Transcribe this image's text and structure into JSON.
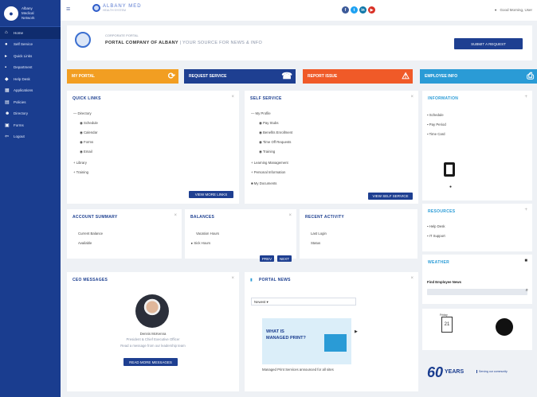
{
  "sidebar": {
    "brand": [
      "Albany",
      "Medical",
      "Network"
    ],
    "items": [
      "Home",
      "Self Service",
      "Quick Links",
      "Department",
      "Help Desk",
      "Applications",
      "Policies",
      "Directory",
      "Forms",
      "Logout"
    ]
  },
  "topbar": {
    "brand": "ALBANY MED",
    "brand_sub": "HEALTH SYSTEM",
    "user": "Good Morning, User"
  },
  "header": {
    "crumb": "CORPORATE PORTAL",
    "title": "PORTAL COMPANY OF ALBANY",
    "subtitle": "| YOUR SOURCE FOR NEWS & INFO",
    "button": "SUBMIT A REQUEST"
  },
  "tiles": [
    "MY PORTAL",
    "REQUEST SERVICE",
    "REPORT ISSUE",
    "EMPLOYEE INFO"
  ],
  "quick_links": {
    "title": "QUICK LINKS",
    "items": [
      "Directory",
      "Schedule",
      "Calendar",
      "Forms",
      "Email",
      "Library",
      "Training"
    ],
    "button": "VIEW MORE LINKS"
  },
  "self_service": {
    "title": "SELF SERVICE",
    "items": [
      "My Profile",
      "Pay Stubs",
      "Benefits Enrollment",
      "Time Off Requests",
      "Training",
      "Learning Management",
      "Personal Information",
      "My Documents"
    ],
    "button": "VIEW SELF SERVICE"
  },
  "right_info": {
    "title": "INFORMATION",
    "items": [
      "Schedule",
      "Pay Period",
      "Time Card"
    ]
  },
  "right_links": {
    "title": "RESOURCES",
    "items": [
      "Help Desk",
      "IT Support"
    ]
  },
  "row2": [
    {
      "title": "ACCOUNT SUMMARY",
      "items": [
        "Current Balance",
        "Available"
      ]
    },
    {
      "title": "BALANCES",
      "items": [
        "Vacation Hours",
        "Sick Hours"
      ]
    },
    {
      "title": "RECENT ACTIVITY",
      "items": [
        "Last Login",
        "Status"
      ]
    }
  ],
  "pager": [
    "PREV",
    "NEXT"
  ],
  "ceo": {
    "title": "CEO MESSAGES",
    "name": "Dennis McKenna",
    "role": "President & Chief Executive Officer",
    "caption": "Read a message from our leadership team",
    "button": "READ MORE MESSAGES"
  },
  "news": {
    "title": "PORTAL NEWS",
    "filter": "Newest",
    "promo_a": "WHAT IS",
    "promo_b": "MANAGED PRINT?",
    "caption": "Managed Print Services announced for all sites"
  },
  "weather": {
    "title": "WEATHER",
    "label": "Find Employee News",
    "day": "21",
    "weekday": "Friday"
  },
  "footer": {
    "years": "60",
    "years_word": "YEARS",
    "tag": "Serving our community"
  }
}
